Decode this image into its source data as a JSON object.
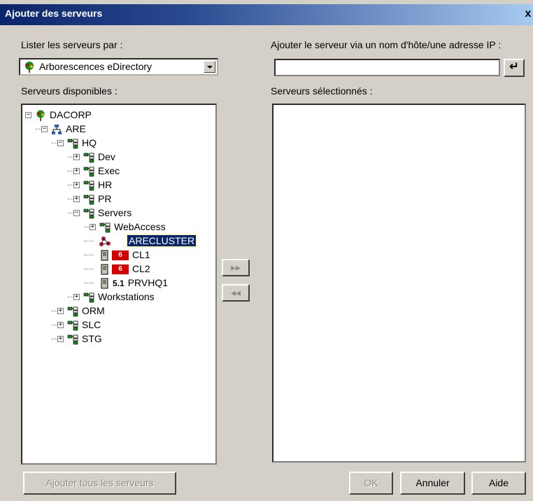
{
  "title": "Ajouter des serveurs",
  "close_label": "x",
  "list_by_label": "Lister les serveurs par :",
  "list_by_value": "Arborescences eDirectory",
  "add_host_label": "Ajouter le serveur via un nom d'hôte/une adresse IP :",
  "host_input_value": "",
  "available_label": "Serveurs disponibles :",
  "selected_label": "Serveurs sélectionnés :",
  "enter_symbol": "↵",
  "tree": [
    {
      "label": "DACORP",
      "level": 0,
      "expander": "−",
      "icon": "tree-icon"
    },
    {
      "label": "ARE",
      "level": 1,
      "expander": "−",
      "icon": "network-icon"
    },
    {
      "label": "HQ",
      "level": 2,
      "expander": "−",
      "icon": "org-unit-icon"
    },
    {
      "label": "Dev",
      "level": 3,
      "expander": "+",
      "icon": "org-unit-icon"
    },
    {
      "label": "Exec",
      "level": 3,
      "expander": "+",
      "icon": "org-unit-icon"
    },
    {
      "label": "HR",
      "level": 3,
      "expander": "+",
      "icon": "org-unit-icon"
    },
    {
      "label": "PR",
      "level": 3,
      "expander": "+",
      "icon": "org-unit-icon"
    },
    {
      "label": "Servers",
      "level": 3,
      "expander": "−",
      "icon": "org-unit-icon"
    },
    {
      "label": "WebAccess",
      "level": 4,
      "expander": "+",
      "icon": "org-unit-icon"
    },
    {
      "label": "ARECLUSTER",
      "level": 4,
      "expander": "",
      "icon": "cluster-icon",
      "selected": true
    },
    {
      "label": "CL1",
      "level": 4,
      "expander": "",
      "icon": "server-icon",
      "badge": "6"
    },
    {
      "label": "CL2",
      "level": 4,
      "expander": "",
      "icon": "server-icon",
      "badge": "6"
    },
    {
      "label": "PRVHQ1",
      "level": 4,
      "expander": "",
      "icon": "server-icon",
      "version": "5.1"
    },
    {
      "label": "Workstations",
      "level": 3,
      "expander": "+",
      "icon": "org-unit-icon"
    },
    {
      "label": "ORM",
      "level": 2,
      "expander": "+",
      "icon": "org-unit-icon"
    },
    {
      "label": "SLC",
      "level": 2,
      "expander": "+",
      "icon": "org-unit-icon"
    },
    {
      "label": "STG",
      "level": 2,
      "expander": "+",
      "icon": "org-unit-icon"
    }
  ],
  "add_arrow": "▸▸",
  "remove_arrow": "◂◂",
  "buttons": {
    "add_all": "Ajouter tous les serveurs",
    "ok": "OK",
    "cancel": "Annuler",
    "help": "Aide"
  },
  "colors": {
    "title_start": "#0a246a",
    "title_end": "#a6caf0",
    "dialog_bg": "#d4d0c8",
    "selection": "#0a246a",
    "badge": "#d40000"
  }
}
